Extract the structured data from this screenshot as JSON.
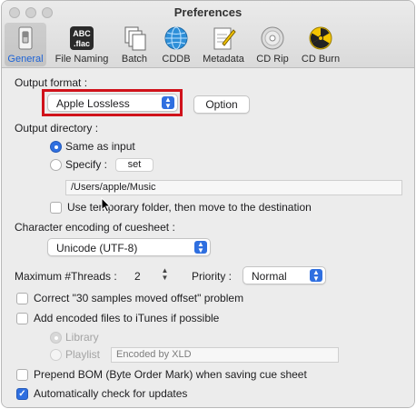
{
  "window": {
    "title": "Preferences"
  },
  "toolbar": {
    "items": [
      {
        "label": "General",
        "icon": "switch-icon",
        "selected": true
      },
      {
        "label": "File Naming",
        "icon": "file-naming-icon",
        "icon_text_line1": "ABC",
        "icon_text_line2": ".flac"
      },
      {
        "label": "Batch",
        "icon": "batch-documents-icon"
      },
      {
        "label": "CDDB",
        "icon": "globe-icon"
      },
      {
        "label": "Metadata",
        "icon": "pencil-doc-icon"
      },
      {
        "label": "CD Rip",
        "icon": "cd-disc-icon"
      },
      {
        "label": "CD Burn",
        "icon": "radiation-icon"
      }
    ]
  },
  "general": {
    "output_format_label": "Output format :",
    "output_format_value": "Apple Lossless",
    "option_button": "Option",
    "output_directory_label": "Output directory :",
    "same_as_input": "Same as input",
    "specify": "Specify :",
    "set_button": "set",
    "directory_path": "/Users/apple/Music",
    "use_temp_folder": "Use temporary folder, then move to the destination",
    "encoding_label": "Character encoding of cuesheet :",
    "encoding_value": "Unicode (UTF-8)",
    "threads_label": "Maximum #Threads :",
    "threads_value": "2",
    "priority_label": "Priority :",
    "priority_value": "Normal",
    "correct_offset": "Correct \"30 samples moved offset\" problem",
    "add_itunes": "Add encoded files to iTunes if possible",
    "library": "Library",
    "playlist": "Playlist",
    "playlist_value": "Encoded by XLD",
    "prepend_bom": "Prepend BOM (Byte Order Mark) when saving cue sheet",
    "auto_check_updates": "Automatically check for updates"
  },
  "colors": {
    "accent": "#2f6fe0",
    "highlight": "#d0121b"
  }
}
